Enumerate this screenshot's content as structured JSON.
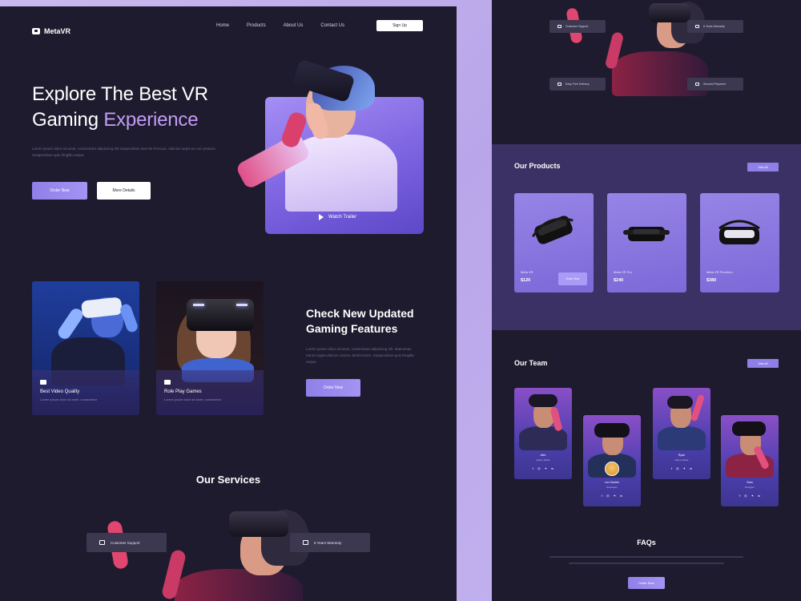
{
  "header": {
    "logo_text": "MetaVR",
    "nav_items": [
      "Home",
      "Products",
      "About Us",
      "Contact Us"
    ],
    "signup_label": "Sign Up"
  },
  "hero": {
    "title_line1": "Explore The Best VR",
    "title_line2_plain": "Gaming ",
    "title_line2_accent": "Experience",
    "description": "Lorem ipsum dolor sit amet, consectetur adipiscing elit suspendisse sed est rhoncus, ultricies turpis eu orci pretium. Suspendisse quis fringilla neque.",
    "order_label": "Order Now",
    "more_label": "More Details",
    "trailer_label": "Watch Trailer"
  },
  "features": {
    "card1_title": "Best Video Quality",
    "card1_desc": "Lorem ipsum dolor sit amet, consectetur",
    "card2_title": "Role Play Games",
    "card2_desc": "Lorem ipsum dolor sit amet, consectetur",
    "heading_line1": "Check New Updated",
    "heading_line2": "Gaming Features",
    "description": "Lorem ipsum dolor sit amet, consectetur adipiscing elit. Maecenas rutrum ligula ultrices viverra. Morbi lorem. Suspendisse quis fringilla neque.",
    "order_label": "Order Now"
  },
  "services": {
    "title": "Our Services",
    "support_label": "Customer Support",
    "warranty_label": "6 Years Warranty"
  },
  "right": {
    "top_pills": [
      "Customer Support",
      "6 Years Warranty",
      "Easy Free Delivery",
      "Secured Payment"
    ],
    "products_title": "Our Products",
    "view_all": "View All",
    "products": [
      {
        "name": "Meta VR",
        "price": "$120"
      },
      {
        "name": "Meta VR Pro",
        "price": "$240"
      },
      {
        "name": "Meta VR Premium",
        "price": "$380"
      }
    ],
    "order_label": "Order Now",
    "team_title": "Our Team",
    "team": [
      {
        "name": "Alex",
        "role": "Game Tester"
      },
      {
        "name": "Leo Garden",
        "role": "Developer"
      },
      {
        "name": "Ryan",
        "role": "Game Tester"
      },
      {
        "name": "Sara",
        "role": "Designer"
      }
    ],
    "faq_title": "FAQs",
    "faq_button": "Order Now"
  },
  "colors": {
    "background": "#1e1b2e",
    "accent": "#8f80e8",
    "accent_text": "#c49cf5",
    "frame": "#c9b8ee"
  }
}
